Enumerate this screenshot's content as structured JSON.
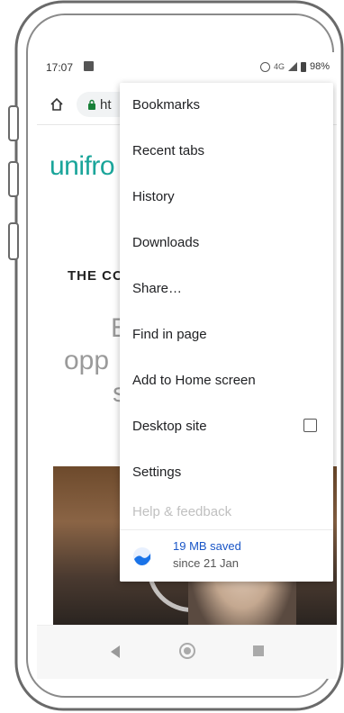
{
  "status_bar": {
    "time": "17:07",
    "network": "4G",
    "battery": "98%"
  },
  "address_bar": {
    "url_prefix": "ht"
  },
  "page": {
    "logo": "unifro",
    "heading": "THE CO",
    "big_text": [
      "E",
      "opp",
      "s"
    ]
  },
  "menu": {
    "items": [
      {
        "label": "Bookmarks"
      },
      {
        "label": "Recent tabs"
      },
      {
        "label": "History"
      },
      {
        "label": "Downloads"
      },
      {
        "label": "Share…"
      },
      {
        "label": "Find in page"
      },
      {
        "label": "Add to Home screen"
      },
      {
        "label": "Desktop site",
        "checked": false
      },
      {
        "label": "Settings"
      },
      {
        "label": "Help & feedback"
      }
    ],
    "footer": {
      "title": "19 MB saved",
      "subtitle": "since 21 Jan"
    }
  },
  "colors": {
    "brand": "#1aa59a",
    "saved_title": "#1a56c7"
  }
}
